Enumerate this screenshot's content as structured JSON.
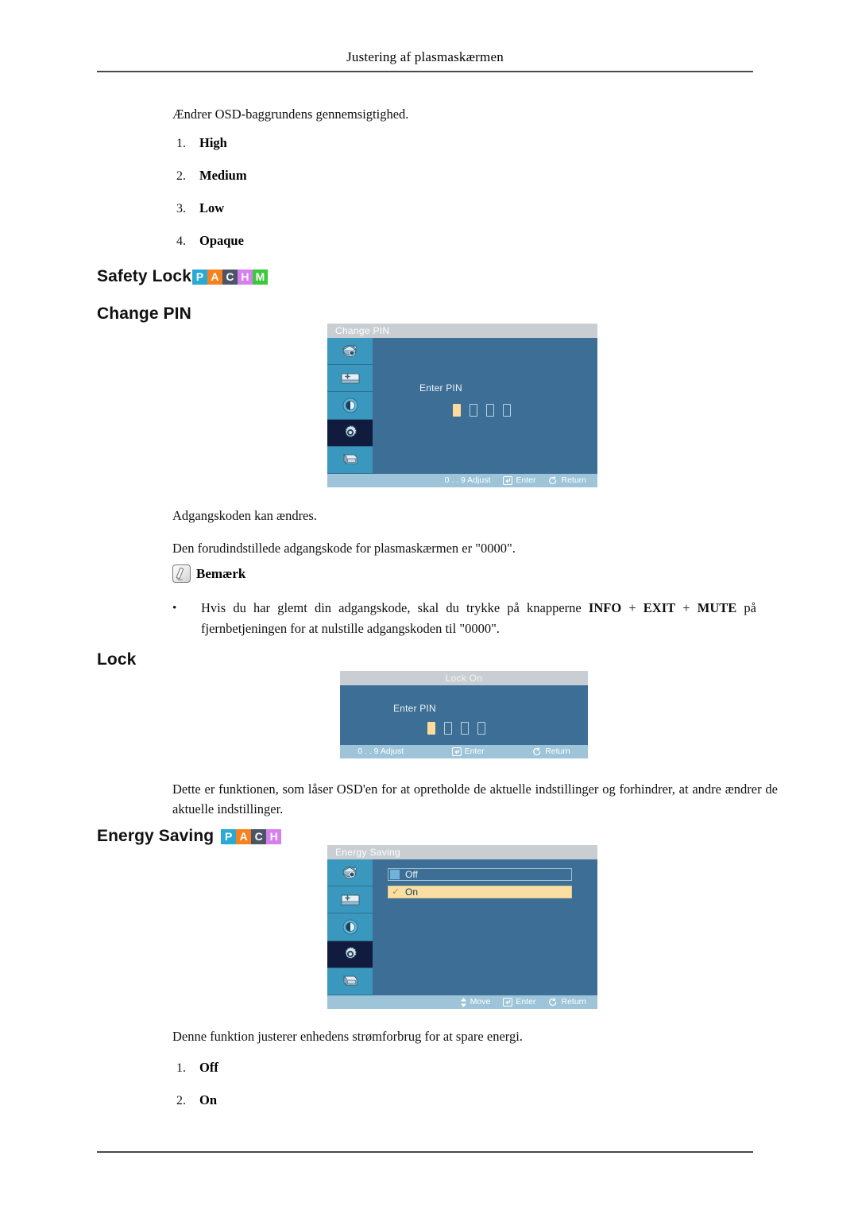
{
  "page": {
    "running_header": "Justering af plasmaskærmen"
  },
  "intro": {
    "text": "Ændrer OSD-baggrundens gennemsigtighed."
  },
  "transparency_list": [
    {
      "num": "1.",
      "label": "High"
    },
    {
      "num": "2.",
      "label": "Medium"
    },
    {
      "num": "3.",
      "label": "Low"
    },
    {
      "num": "4.",
      "label": "Opaque"
    }
  ],
  "safety_lock": {
    "heading": "Safety Lock",
    "badges": [
      {
        "letter": "P",
        "color": "#29a9d4"
      },
      {
        "letter": "A",
        "color": "#f5821f"
      },
      {
        "letter": "C",
        "color": "#4c5566"
      },
      {
        "letter": "H",
        "color": "#d77ff0"
      },
      {
        "letter": "M",
        "color": "#3cc83c"
      }
    ]
  },
  "change_pin": {
    "heading": "Change PIN",
    "osd": {
      "title": "Change PIN",
      "enter_pin_label": "Enter PIN",
      "pin_boxes": [
        true,
        false,
        false,
        false
      ],
      "sidebar_icons": [
        {
          "name": "input-source-icon",
          "active": false
        },
        {
          "name": "picture-adjust-icon",
          "active": false
        },
        {
          "name": "color-tone-icon",
          "active": false
        },
        {
          "name": "setup-gear-icon",
          "active": true
        },
        {
          "name": "multi-control-icon",
          "active": false
        }
      ],
      "footer": [
        {
          "icon": "digits",
          "label": "0 . . 9 Adjust"
        },
        {
          "icon": "enter",
          "label": "Enter"
        },
        {
          "icon": "return",
          "label": "Return"
        }
      ]
    },
    "paragraph_1": "Adgangskoden kan ændres.",
    "paragraph_2": "Den forudindstillede adgangskode for plasmaskærmen er \"0000\".",
    "note_label": "Bemærk",
    "note_bullet": {
      "prefix": "Hvis du har glemt din adgangskode, skal du trykke på knapperne ",
      "key_1": "INFO",
      "sep_1": " + ",
      "key_2": "EXIT",
      "sep_2": " + ",
      "key_3": "MUTE",
      "suffix": " på fjernbetjeningen for at nulstille adgangskoden til \"0000\"."
    }
  },
  "lock": {
    "heading": "Lock",
    "osd": {
      "title": "Lock On",
      "enter_pin_label": "Enter PIN",
      "pin_boxes": [
        true,
        false,
        false,
        false
      ],
      "footer": [
        {
          "icon": "digits",
          "label": "0 . . 9 Adjust"
        },
        {
          "icon": "enter",
          "label": "Enter"
        },
        {
          "icon": "return",
          "label": "Return"
        }
      ]
    },
    "paragraph": "Dette er funktionen, som låser OSD'en for at opretholde de aktuelle indstillinger og forhindrer, at andre ændrer de aktuelle indstillinger."
  },
  "energy_saving": {
    "heading": "Energy Saving",
    "badges": [
      {
        "letter": "P",
        "color": "#29a9d4"
      },
      {
        "letter": "A",
        "color": "#f5821f"
      },
      {
        "letter": "C",
        "color": "#4c5566"
      },
      {
        "letter": "H",
        "color": "#d77ff0"
      }
    ],
    "osd": {
      "title": "Energy Saving",
      "options": [
        {
          "label": "Off",
          "selected": false
        },
        {
          "label": "On",
          "selected": true
        }
      ],
      "sidebar_icons": [
        {
          "name": "input-source-icon",
          "active": false
        },
        {
          "name": "picture-adjust-icon",
          "active": false
        },
        {
          "name": "color-tone-icon",
          "active": false
        },
        {
          "name": "setup-gear-icon",
          "active": true
        },
        {
          "name": "multi-control-icon",
          "active": false
        }
      ],
      "footer": [
        {
          "icon": "move",
          "label": "Move"
        },
        {
          "icon": "enter",
          "label": "Enter"
        },
        {
          "icon": "return",
          "label": "Return"
        }
      ]
    },
    "paragraph": "Denne funktion justerer enhedens strømforbrug for at spare energi.",
    "list": [
      {
        "num": "1.",
        "label": "Off"
      },
      {
        "num": "2.",
        "label": "On"
      }
    ]
  }
}
